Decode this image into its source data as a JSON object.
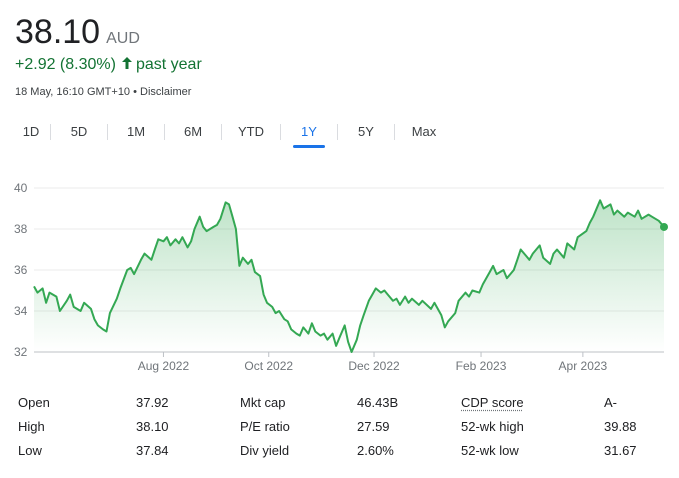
{
  "quote": {
    "price": "38.10",
    "currency": "AUD",
    "change": "+2.92 (8.30%)",
    "change_period": "past year",
    "timestamp": "18 May, 16:10 GMT+10",
    "separator": "•",
    "disclaimer": "Disclaimer"
  },
  "colors": {
    "positive": "#137333",
    "line": "#34a853",
    "accent": "#1a73e8"
  },
  "tabs": [
    {
      "label": "1D"
    },
    {
      "label": "5D"
    },
    {
      "label": "1M"
    },
    {
      "label": "6M"
    },
    {
      "label": "YTD"
    },
    {
      "label": "1Y",
      "active": true
    },
    {
      "label": "5Y"
    },
    {
      "label": "Max"
    }
  ],
  "chart_data": {
    "type": "area",
    "ylim": [
      32,
      40
    ],
    "yticks": [
      "40",
      "38",
      "36",
      "34",
      "32"
    ],
    "x_ticks": [
      {
        "label": "Aug 2022",
        "date": "2022-08-01"
      },
      {
        "label": "Oct 2022",
        "date": "2022-10-01"
      },
      {
        "label": "Dec 2022",
        "date": "2022-12-01"
      },
      {
        "label": "Feb 2023",
        "date": "2023-02-01"
      },
      {
        "label": "Apr 2023",
        "date": "2023-04-01"
      }
    ],
    "x_start": "2022-05-18",
    "x_end": "2023-05-18",
    "series": [
      {
        "values": [
          [
            "2022-05-18",
            35.2
          ],
          [
            "2022-05-20",
            34.9
          ],
          [
            "2022-05-23",
            35.1
          ],
          [
            "2022-05-25",
            34.4
          ],
          [
            "2022-05-27",
            34.9
          ],
          [
            "2022-05-31",
            34.7
          ],
          [
            "2022-06-02",
            34.0
          ],
          [
            "2022-06-06",
            34.5
          ],
          [
            "2022-06-08",
            34.8
          ],
          [
            "2022-06-10",
            34.2
          ],
          [
            "2022-06-14",
            34.0
          ],
          [
            "2022-06-16",
            34.4
          ],
          [
            "2022-06-20",
            34.1
          ],
          [
            "2022-06-22",
            33.6
          ],
          [
            "2022-06-24",
            33.3
          ],
          [
            "2022-06-27",
            33.1
          ],
          [
            "2022-06-29",
            33.0
          ],
          [
            "2022-07-01",
            33.9
          ],
          [
            "2022-07-05",
            34.6
          ],
          [
            "2022-07-07",
            35.1
          ],
          [
            "2022-07-11",
            36.0
          ],
          [
            "2022-07-13",
            36.1
          ],
          [
            "2022-07-15",
            35.8
          ],
          [
            "2022-07-19",
            36.5
          ],
          [
            "2022-07-21",
            36.8
          ],
          [
            "2022-07-25",
            36.5
          ],
          [
            "2022-07-27",
            37.0
          ],
          [
            "2022-07-29",
            37.5
          ],
          [
            "2022-08-01",
            37.4
          ],
          [
            "2022-08-03",
            37.6
          ],
          [
            "2022-08-05",
            37.2
          ],
          [
            "2022-08-08",
            37.5
          ],
          [
            "2022-08-10",
            37.3
          ],
          [
            "2022-08-12",
            37.6
          ],
          [
            "2022-08-15",
            37.1
          ],
          [
            "2022-08-17",
            37.4
          ],
          [
            "2022-08-19",
            38.0
          ],
          [
            "2022-08-22",
            38.6
          ],
          [
            "2022-08-24",
            38.1
          ],
          [
            "2022-08-26",
            37.9
          ],
          [
            "2022-08-30",
            38.1
          ],
          [
            "2022-09-01",
            38.2
          ],
          [
            "2022-09-03",
            38.5
          ],
          [
            "2022-09-06",
            39.3
          ],
          [
            "2022-09-08",
            39.2
          ],
          [
            "2022-09-10",
            38.6
          ],
          [
            "2022-09-12",
            38.0
          ],
          [
            "2022-09-14",
            36.2
          ],
          [
            "2022-09-16",
            36.6
          ],
          [
            "2022-09-19",
            36.3
          ],
          [
            "2022-09-21",
            36.5
          ],
          [
            "2022-09-23",
            35.9
          ],
          [
            "2022-09-26",
            35.7
          ],
          [
            "2022-09-28",
            34.8
          ],
          [
            "2022-09-30",
            34.4
          ],
          [
            "2022-10-03",
            34.2
          ],
          [
            "2022-10-05",
            33.9
          ],
          [
            "2022-10-07",
            34.0
          ],
          [
            "2022-10-10",
            33.6
          ],
          [
            "2022-10-12",
            33.5
          ],
          [
            "2022-10-14",
            33.1
          ],
          [
            "2022-10-17",
            32.9
          ],
          [
            "2022-10-19",
            32.8
          ],
          [
            "2022-10-21",
            33.2
          ],
          [
            "2022-10-24",
            32.9
          ],
          [
            "2022-10-26",
            33.4
          ],
          [
            "2022-10-28",
            33.0
          ],
          [
            "2022-10-31",
            32.8
          ],
          [
            "2022-11-02",
            32.9
          ],
          [
            "2022-11-04",
            32.6
          ],
          [
            "2022-11-07",
            32.9
          ],
          [
            "2022-11-09",
            32.3
          ],
          [
            "2022-11-11",
            32.7
          ],
          [
            "2022-11-14",
            33.3
          ],
          [
            "2022-11-16",
            32.5
          ],
          [
            "2022-11-18",
            32.0
          ],
          [
            "2022-11-21",
            32.6
          ],
          [
            "2022-11-23",
            33.3
          ],
          [
            "2022-11-25",
            33.8
          ],
          [
            "2022-11-28",
            34.5
          ],
          [
            "2022-11-30",
            34.8
          ],
          [
            "2022-12-02",
            35.1
          ],
          [
            "2022-12-05",
            34.9
          ],
          [
            "2022-12-07",
            35.0
          ],
          [
            "2022-12-09",
            34.8
          ],
          [
            "2022-12-12",
            34.5
          ],
          [
            "2022-12-14",
            34.6
          ],
          [
            "2022-12-16",
            34.3
          ],
          [
            "2022-12-19",
            34.7
          ],
          [
            "2022-12-21",
            34.4
          ],
          [
            "2022-12-23",
            34.6
          ],
          [
            "2022-12-27",
            34.3
          ],
          [
            "2022-12-29",
            34.5
          ],
          [
            "2023-01-03",
            34.1
          ],
          [
            "2023-01-05",
            34.4
          ],
          [
            "2023-01-09",
            33.8
          ],
          [
            "2023-01-11",
            33.2
          ],
          [
            "2023-01-13",
            33.5
          ],
          [
            "2023-01-17",
            33.9
          ],
          [
            "2023-01-19",
            34.5
          ],
          [
            "2023-01-23",
            34.9
          ],
          [
            "2023-01-25",
            34.7
          ],
          [
            "2023-01-27",
            35.0
          ],
          [
            "2023-01-31",
            34.9
          ],
          [
            "2023-02-02",
            35.3
          ],
          [
            "2023-02-06",
            35.9
          ],
          [
            "2023-02-08",
            36.2
          ],
          [
            "2023-02-10",
            35.8
          ],
          [
            "2023-02-14",
            36.0
          ],
          [
            "2023-02-16",
            35.6
          ],
          [
            "2023-02-20",
            36.0
          ],
          [
            "2023-02-22",
            36.5
          ],
          [
            "2023-02-24",
            37.0
          ],
          [
            "2023-02-27",
            36.7
          ],
          [
            "2023-03-01",
            36.5
          ],
          [
            "2023-03-03",
            36.8
          ],
          [
            "2023-03-07",
            37.2
          ],
          [
            "2023-03-09",
            36.6
          ],
          [
            "2023-03-13",
            36.3
          ],
          [
            "2023-03-15",
            36.8
          ],
          [
            "2023-03-17",
            37.0
          ],
          [
            "2023-03-21",
            36.6
          ],
          [
            "2023-03-23",
            37.3
          ],
          [
            "2023-03-27",
            37.0
          ],
          [
            "2023-03-29",
            37.6
          ],
          [
            "2023-04-03",
            37.9
          ],
          [
            "2023-04-05",
            38.3
          ],
          [
            "2023-04-07",
            38.6
          ],
          [
            "2023-04-11",
            39.4
          ],
          [
            "2023-04-13",
            39.0
          ],
          [
            "2023-04-17",
            39.2
          ],
          [
            "2023-04-19",
            38.7
          ],
          [
            "2023-04-21",
            38.9
          ],
          [
            "2023-04-25",
            38.6
          ],
          [
            "2023-04-27",
            38.8
          ],
          [
            "2023-05-01",
            38.6
          ],
          [
            "2023-05-03",
            38.9
          ],
          [
            "2023-05-05",
            38.5
          ],
          [
            "2023-05-09",
            38.7
          ],
          [
            "2023-05-11",
            38.6
          ],
          [
            "2023-05-15",
            38.4
          ],
          [
            "2023-05-18",
            38.1
          ]
        ]
      }
    ]
  },
  "stats": [
    [
      {
        "label": "Open",
        "value": "37.92"
      },
      {
        "label": "Mkt cap",
        "value": "46.43B"
      },
      {
        "label": "CDP score",
        "value": "A-"
      }
    ],
    [
      {
        "label": "High",
        "value": "38.10"
      },
      {
        "label": "P/E ratio",
        "value": "27.59"
      },
      {
        "label": "52-wk high",
        "value": "39.88"
      }
    ],
    [
      {
        "label": "Low",
        "value": "37.84"
      },
      {
        "label": "Div yield",
        "value": "2.60%"
      },
      {
        "label": "52-wk low",
        "value": "31.67"
      }
    ]
  ]
}
